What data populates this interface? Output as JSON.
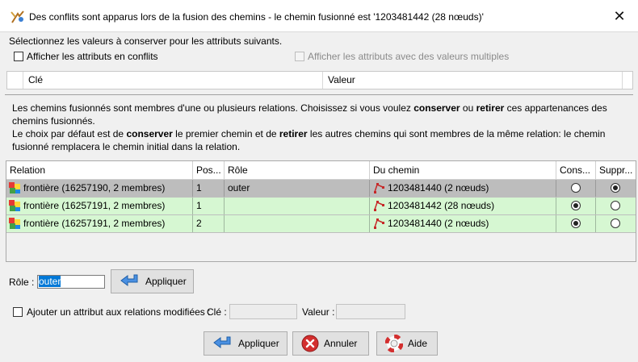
{
  "window": {
    "title": "Des conflits sont apparus lors de la fusion des chemins - le chemin fusionné est '1203481442 (28 nœuds)'",
    "close_glyph": "✕"
  },
  "tags": {
    "intro": "Sélectionnez les valeurs à conserver pour les attributs suivants.",
    "show_conflicts_label": "Afficher les attributs en conflits",
    "show_multiple_label": "Afficher les attributs avec des valeurs multiples",
    "col_key": "Clé",
    "col_value": "Valeur"
  },
  "relations_info": {
    "line1_a": "Les chemins fusionnés sont membres d'une ou plusieurs relations. Choisissez si vous voulez ",
    "line1_b": "conserver",
    "line1_c": " ou ",
    "line1_d": "retirer",
    "line1_e": " ces appartenances des chemins fusionnés.",
    "line2_a": "Le choix par défaut est de ",
    "line2_b": "conserver",
    "line2_c": " le premier chemin et de ",
    "line2_d": "retirer",
    "line2_e": " les autres chemins qui sont membres de la même relation: le chemin fusionné remplacera le chemin initial dans la relation."
  },
  "table": {
    "headers": [
      "Relation",
      "Pos...",
      "Rôle",
      "Du chemin",
      "Cons...",
      "Suppr..."
    ],
    "rows": [
      {
        "relation": "frontière (16257190, 2 membres)",
        "pos": "1",
        "role": "outer",
        "way": "1203481440 (2 nœuds)",
        "keep": false,
        "remove": true,
        "state": "selected"
      },
      {
        "relation": "frontière (16257191, 2 membres)",
        "pos": "1",
        "role": "",
        "way": "1203481442 (28 nœuds)",
        "keep": true,
        "remove": false,
        "state": "green"
      },
      {
        "relation": "frontière (16257191, 2 membres)",
        "pos": "2",
        "role": "",
        "way": "1203481440 (2 nœuds)",
        "keep": true,
        "remove": false,
        "state": "green"
      }
    ]
  },
  "role_editor": {
    "label": "Rôle :",
    "value": "outer",
    "apply_label": "Appliquer"
  },
  "add_attribute": {
    "label": "Ajouter un attribut aux relations modifiées :",
    "key_label": "Clé :",
    "value_label": "Valeur :"
  },
  "footer": {
    "apply_label": "Appliquer",
    "cancel_label": "Annuler",
    "help_label": "Aide"
  },
  "icons": {
    "app": "josm-icon",
    "relation": "relation-icon",
    "way": "way-icon",
    "apply": "arrow-left-icon",
    "cancel": "cancel-icon",
    "help": "lifebuoy-icon"
  },
  "colors": {
    "selected_row": "#bdbdbd",
    "green_row": "#d6f7d2",
    "selection_highlight": "#0078d7"
  }
}
